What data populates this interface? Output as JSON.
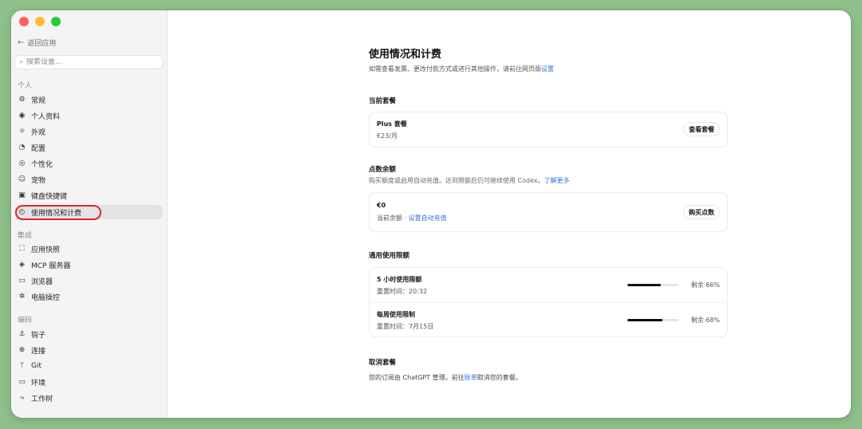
{
  "colors": {
    "accent_link": "#2b74d8",
    "highlight_ring": "#e0242b",
    "traffic_red": "#ff5f57",
    "traffic_yellow": "#febc2e",
    "traffic_green": "#28c840"
  },
  "sidebar": {
    "back_label": "返回应用",
    "search_placeholder": "搜索设置...",
    "sections": [
      {
        "label": "个人",
        "items": [
          {
            "label": "常规",
            "icon": "gear-icon"
          },
          {
            "label": "个人资料",
            "icon": "profile-icon"
          },
          {
            "label": "外观",
            "icon": "sun-icon"
          },
          {
            "label": "配置",
            "icon": "config-icon"
          },
          {
            "label": "个性化",
            "icon": "personalize-icon"
          },
          {
            "label": "宠物",
            "icon": "pet-icon"
          },
          {
            "label": "键盘快捷键",
            "icon": "keyboard-icon"
          },
          {
            "label": "使用情况和计费",
            "icon": "usage-icon",
            "active": true
          }
        ]
      },
      {
        "label": "集成",
        "items": [
          {
            "label": "应用快照",
            "icon": "snapshot-icon"
          },
          {
            "label": "MCP 服务器",
            "icon": "mcp-icon"
          },
          {
            "label": "浏览器",
            "icon": "browser-icon"
          },
          {
            "label": "电脑操控",
            "icon": "computer-control-icon"
          }
        ]
      },
      {
        "label": "编码",
        "items": [
          {
            "label": "钩子",
            "icon": "hook-icon"
          },
          {
            "label": "连接",
            "icon": "globe-icon"
          },
          {
            "label": "Git",
            "icon": "git-icon"
          },
          {
            "label": "环境",
            "icon": "environment-icon"
          },
          {
            "label": "工作树",
            "icon": "worktree-icon"
          }
        ]
      }
    ]
  },
  "main": {
    "title": "使用情况和计费",
    "subtitle_prefix": "如需查看发票、更改付款方式或进行其他操作，请前往网页版",
    "subtitle_link": "设置",
    "current_plan": {
      "section_title": "当前套餐",
      "plan_name": "Plus 套餐",
      "price": "€23/月",
      "button": "查看套餐"
    },
    "credits": {
      "section_title": "点数余额",
      "desc_prefix": "购买额度或启用自动充值。达到限额后仍可继续使用 Codex。",
      "desc_link": "了解更多",
      "amount": "€0",
      "balance_prefix": "当前余额 · ",
      "balance_link": "设置自动充值",
      "button": "购买点数"
    },
    "limits": {
      "section_title": "通用使用限额",
      "items": [
        {
          "title": "5 小时使用限额",
          "reset": "重置时间：20:32",
          "remaining_label": "剩余 66%",
          "used_fraction": 0.66
        },
        {
          "title": "每周使用限制",
          "reset": "重置时间：7月15日",
          "remaining_label": "剩余 68%",
          "used_fraction": 0.68
        }
      ]
    },
    "cancel": {
      "section_title": "取消套餐",
      "desc_prefix": "您的订阅由 ChatGPT 管理。前往",
      "desc_link": "账单",
      "desc_suffix": "取消您的套餐。"
    }
  }
}
